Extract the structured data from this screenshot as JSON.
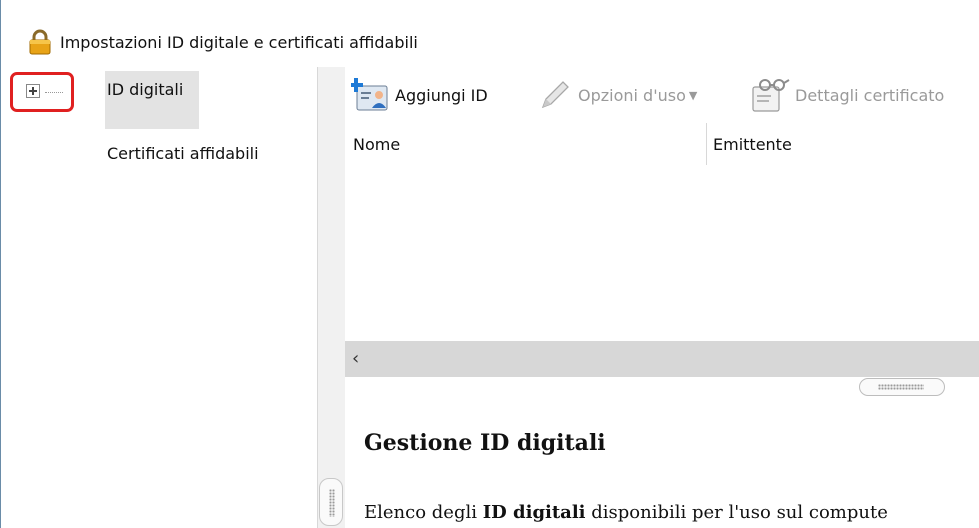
{
  "window": {
    "title": "Impostazioni ID digitale e certificati affidabili"
  },
  "tree": {
    "items": [
      {
        "label": "ID digitali",
        "selected": true,
        "icon": "expand-plus-icon"
      },
      {
        "label": "Certificati affidabili",
        "selected": false
      }
    ]
  },
  "toolbar": {
    "add_id_label": "Aggiungi ID",
    "usage_options_label": "Opzioni d'uso",
    "certificate_details_label": "Dettagli certificato"
  },
  "list": {
    "columns": [
      "Nome",
      "Emittente"
    ],
    "rows": []
  },
  "help": {
    "title": "Gestione ID digitali",
    "text_before": "Elenco degli ",
    "text_bold": "ID digitali",
    "text_after": " disponibili per l'uso sul compute"
  },
  "colors": {
    "highlight": "#e02020",
    "selection": "#e3e3e3",
    "scrollbar": "#d7d7d7",
    "disabled_text": "#9a9a9a"
  }
}
